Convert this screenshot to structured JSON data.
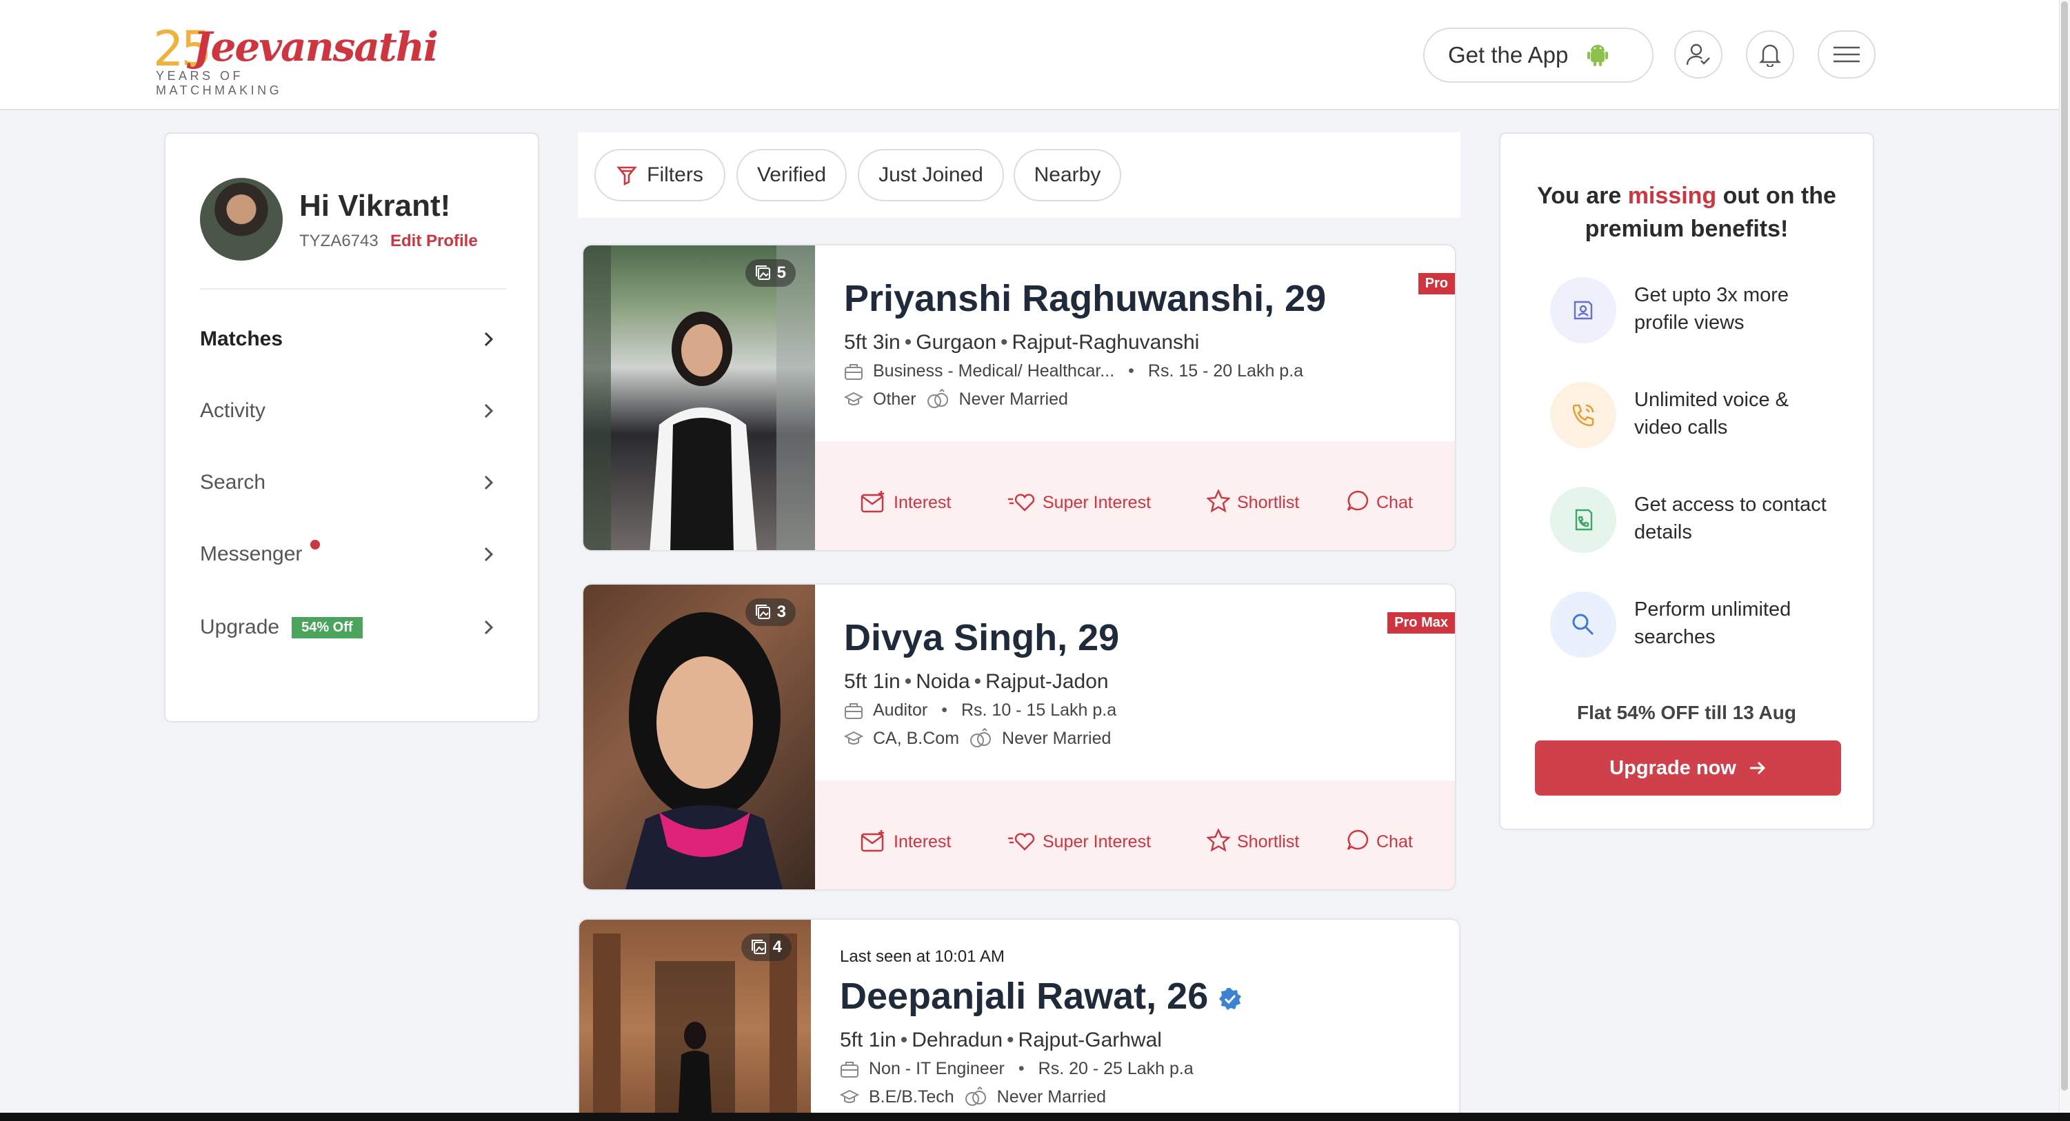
{
  "header": {
    "logo_number": "25",
    "logo_brand": "Jeevansathi",
    "logo_tagline": "YEARS OF MATCHMAKING",
    "get_app_label": "Get the App",
    "icons": [
      "apple-icon",
      "android-icon",
      "profile-icon",
      "bell-icon",
      "menu-icon"
    ]
  },
  "sidebar": {
    "greeting": "Hi Vikrant!",
    "user_id": "TYZA6743",
    "edit_profile": "Edit Profile",
    "items": [
      {
        "label": "Matches",
        "active": true
      },
      {
        "label": "Activity"
      },
      {
        "label": "Search"
      },
      {
        "label": "Messenger",
        "notification_dot": true
      },
      {
        "label": "Upgrade",
        "badge": "54% Off"
      }
    ]
  },
  "filters": {
    "items": [
      "Filters",
      "Verified",
      "Just Joined",
      "Nearby"
    ]
  },
  "profiles": [
    {
      "name": "Priyanshi Raghuwanshi, 29",
      "photo_count": "5",
      "tag": "Pro",
      "height": "5ft 3in",
      "city": "Gurgaon",
      "community": "Rajput-Raghuvanshi",
      "occupation": "Business - Medical/ Healthcar...",
      "income": "Rs. 15 - 20 Lakh p.a",
      "education": "Other",
      "marital": "Never Married"
    },
    {
      "name": "Divya Singh, 29",
      "photo_count": "3",
      "tag": "Pro Max",
      "height": "5ft 1in",
      "city": "Noida",
      "community": "Rajput-Jadon",
      "occupation": "Auditor",
      "income": "Rs. 10 - 15 Lakh p.a",
      "education": "CA, B.Com",
      "marital": "Never Married"
    },
    {
      "last_seen": "Last seen at 10:01 AM",
      "name": "Deepanjali Rawat, 26",
      "photo_count": "4",
      "height": "5ft 1in",
      "city": "Dehradun",
      "community": "Rajput-Garhwal",
      "occupation": "Non - IT Engineer",
      "income": "Rs. 20 - 25 Lakh p.a",
      "education": "B.E/B.Tech",
      "marital": "Never Married"
    }
  ],
  "actions": {
    "interest": "Interest",
    "super_interest": "Super Interest",
    "shortlist": "Shortlist",
    "chat": "Chat"
  },
  "promo": {
    "title_pre": "You are ",
    "title_highlight": "missing",
    "title_post": " out on the premium benefits!",
    "benefits": [
      {
        "text": "Get upto 3x more profile views",
        "icon": "profile-views-icon"
      },
      {
        "text": "Unlimited voice & video calls",
        "icon": "phone-icon"
      },
      {
        "text": "Get access to contact details",
        "icon": "contact-icon"
      },
      {
        "text": "Perform unlimited searches",
        "icon": "search-icon"
      }
    ],
    "offer": "Flat 54% OFF till 13 Aug",
    "cta": "Upgrade now"
  },
  "colors": {
    "brand_red": "#d0343f",
    "accent_gold": "#f0b23c",
    "badge_green": "#4aa45c",
    "action_bg": "#fdf0f1"
  }
}
